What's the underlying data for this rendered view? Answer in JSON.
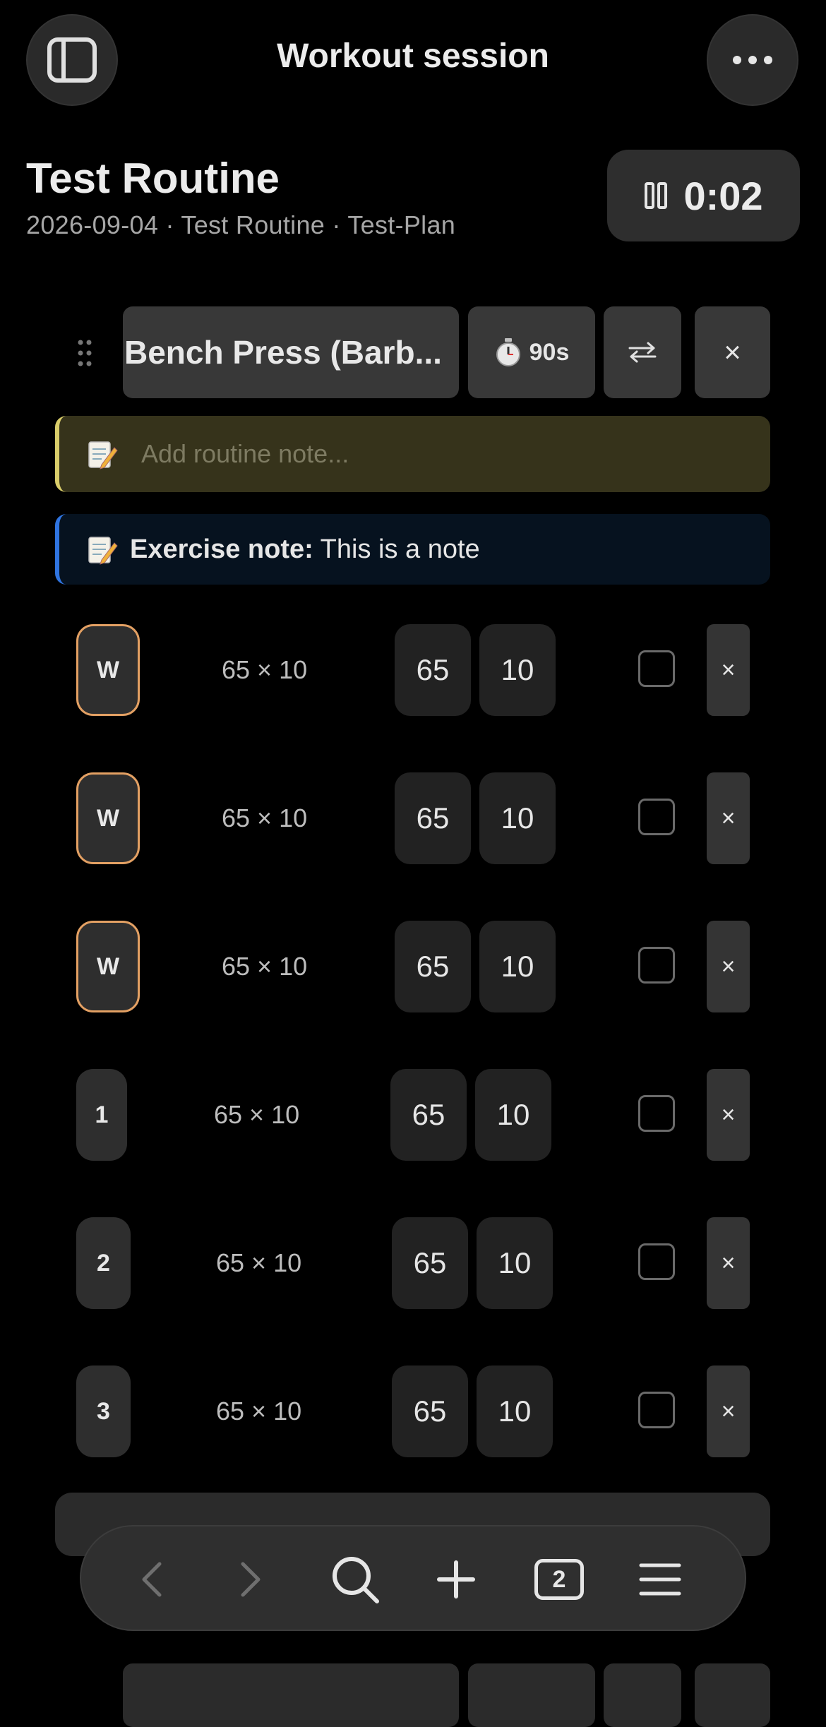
{
  "header": {
    "title": "Workout session",
    "sidebar_icon": "sidebar-icon",
    "more_icon": "more-dots-icon"
  },
  "routine": {
    "title": "Test Routine",
    "subtitle": "2026-09-04 · Test Routine · Test-Plan",
    "timer": "0:02"
  },
  "exercise": {
    "name": "Bench Press (Barb...",
    "rest": "90s",
    "routine_note_placeholder": "Add routine note...",
    "exercise_note_label": "Exercise note:",
    "exercise_note_text": " This is a note"
  },
  "sets": [
    {
      "label": "W",
      "warmup": true,
      "previous": "65 × 10",
      "weight": "65",
      "reps": "10"
    },
    {
      "label": "W",
      "warmup": true,
      "previous": "65 × 10",
      "weight": "65",
      "reps": "10"
    },
    {
      "label": "W",
      "warmup": true,
      "previous": "65 × 10",
      "weight": "65",
      "reps": "10"
    },
    {
      "label": "1",
      "warmup": false,
      "previous": "65 × 10",
      "weight": "65",
      "reps": "10"
    },
    {
      "label": "2",
      "warmup": false,
      "previous": "65 × 10",
      "weight": "65",
      "reps": "10"
    },
    {
      "label": "3",
      "warmup": false,
      "previous": "65 × 10",
      "weight": "65",
      "reps": "10"
    }
  ],
  "toolbar": {
    "tab_count": "2"
  },
  "colors": {
    "warmup_border": "#e3a063",
    "routine_note_accent": "#d9cd6a",
    "exercise_note_accent": "#2f74e0"
  }
}
